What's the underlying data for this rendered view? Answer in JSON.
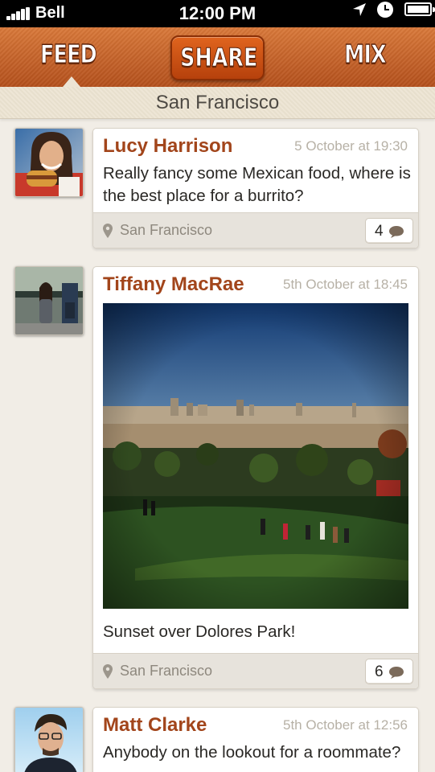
{
  "status_bar": {
    "carrier": "Bell",
    "time": "12:00 PM"
  },
  "nav": {
    "feed_label": "FEED",
    "share_label": "SHARE",
    "mix_label": "MIX"
  },
  "location_header": "San Francisco",
  "posts": [
    {
      "author": "Lucy Harrison",
      "time": "5 October at 19:30",
      "text": "Really fancy some Mexican food, where is the best place for a burrito?",
      "location": "San Francisco",
      "comments": "4"
    },
    {
      "author": "Tiffany MacRae",
      "time": "5th October at 18:45",
      "text": "Sunset over Dolores Park!",
      "location": "San Francisco",
      "comments": "6"
    },
    {
      "author": "Matt Clarke",
      "time": "5th October at 12:56",
      "text": "Anybody on the lookout for a roommate?"
    }
  ],
  "colors": {
    "brand_orange": "#c3602a",
    "author_name": "#a2451b",
    "background": "#f1ede6"
  },
  "icons": [
    "signal-icon",
    "location-arrow-icon",
    "clock-icon",
    "battery-icon",
    "map-pin-icon",
    "speech-bubble-icon"
  ]
}
